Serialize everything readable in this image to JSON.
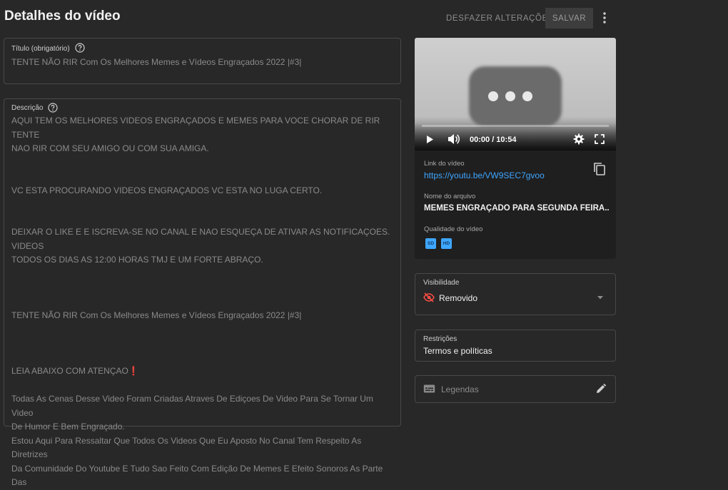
{
  "header": {
    "title": "Detalhes do vídeo",
    "undo_label": "DESFAZER ALTERAÇÕES",
    "save_label": "SALVAR"
  },
  "title_field": {
    "label": "Título (obrigatório)",
    "value": "TENTE NÃO RIR Com Os Melhores Memes e Vídeos Engraçados 2022 |#3|"
  },
  "description_field": {
    "label": "Descrição",
    "value": "AQUI TEM OS MELHORES VIDEOS ENGRAÇADOS E MEMES PARA VOCE CHORAR DE RIR TENTE\nNAO RIR COM SEU AMIGO OU COM SUA AMIGA.\n\n\nVC ESTA PROCURANDO VIDEOS ENGRAÇADOS VC ESTA NO LUGA CERTO.\n\n\nDEIXAR O LIKE E E ISCREVA-SE NO CANAL E NAO ESQUEÇA DE ATIVAR AS NOTIFICAÇOES. VIDEOS\nTODOS OS DIAS AS 12:00 HORAS TMJ E UM FORTE ABRAÇO.\n\n\n\nTENTE NÃO RIR Com Os Melhores Memes e Vídeos Engraçados 2022 |#3|\n\n\n\nLEIA ABAIXO COM ATENÇAO❗\n\nTodas As Cenas Desse Video Foram Criadas Atraves De Ediçoes De Video Para Se Tornar Um Video\nDe Humor E Bem Engraçado.\nEstou Aqui Para Ressaltar Que Todos Os Videos Que Eu Aposto No Canal Tem Respeito As Diretrizes\nDa Comunidade Do Youtube E Tudo Sao Feito Com Edição De Memes E Efeito Sonoros As Parte Das"
  },
  "player": {
    "time": "00:00 / 10:54",
    "progress": 0
  },
  "video_info": {
    "link_label": "Link do vídeo",
    "link": "https://youtu.be/VW9SEC7gvoo",
    "filename_label": "Nome do arquivo",
    "filename": "MEMES ENGRAÇADO PARA SEGUNDA FEIRA...",
    "quality_label": "Qualidade do vídeo",
    "quality_badges": [
      "SD",
      "HD"
    ]
  },
  "visibility": {
    "label": "Visibilidade",
    "value": "Removido",
    "icon": "eye-off-icon",
    "icon_color": "#ff4e45"
  },
  "restrictions": {
    "label": "Restrições",
    "value": "Termos e políticas"
  },
  "subtitles": {
    "label": "Legendas"
  }
}
